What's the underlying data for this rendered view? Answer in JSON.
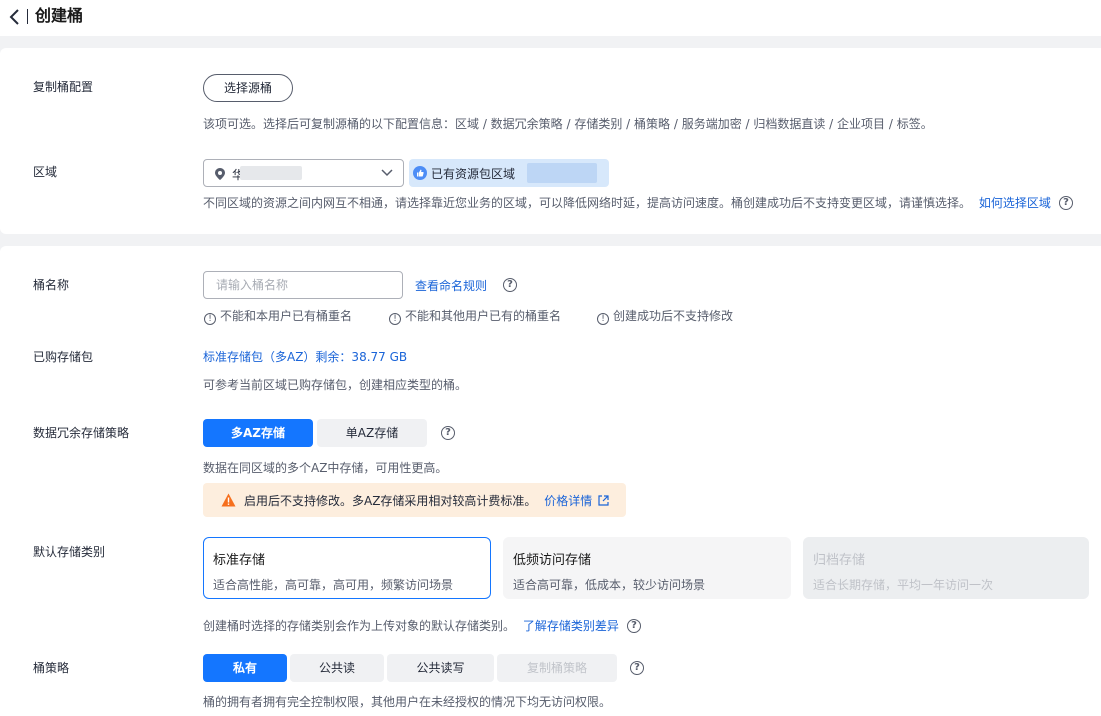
{
  "header": {
    "title": "创建桶"
  },
  "replicate": {
    "label": "复制桶配置",
    "button": "选择源桶",
    "hint": "该项可选。选择后可复制源桶的以下配置信息：区域 / 数据冗余策略 / 存储类别 / 桶策略 / 服务端加密 / 归档数据直读 / 企业项目 / 标签。"
  },
  "region": {
    "label": "区域",
    "select_value": "华",
    "resource_tag": "已有资源包区域",
    "hint": "不同区域的资源之间内网互不相通，请选择靠近您业务的区域，可以降低网络时延，提高访问速度。桶创建成功后不支持变更区域，请谨慎选择。",
    "link": "如何选择区域"
  },
  "bucket_name": {
    "label": "桶名称",
    "placeholder": "请输入桶名称",
    "link": "查看命名规则",
    "rules": [
      "不能和本用户已有桶重名",
      "不能和其他用户已有的桶重名",
      "创建成功后不支持修改"
    ]
  },
  "package": {
    "label": "已购存储包",
    "value": "标准存储包（多AZ）剩余：38.77 GB",
    "hint": "可参考当前区域已购存储包，创建相应类型的桶。"
  },
  "redundancy": {
    "label": "数据冗余存储策略",
    "options": [
      "多AZ存储",
      "单AZ存储"
    ],
    "selected": 0,
    "hint": "数据在同区域的多个AZ中存储，可用性更高。",
    "warning": "启用后不支持修改。多AZ存储采用相对较高计费标准。",
    "warning_link": "价格详情"
  },
  "storage_class": {
    "label": "默认存储类别",
    "options": [
      {
        "title": "标准存储",
        "desc": "适合高性能，高可靠，高可用，频繁访问场景"
      },
      {
        "title": "低频访问存储",
        "desc": "适合高可靠，低成本，较少访问场景"
      },
      {
        "title": "归档存储",
        "desc": "适合长期存储，平均一年访问一次"
      }
    ],
    "hint": "创建桶时选择的存储类别会作为上传对象的默认存储类别。",
    "link": "了解存储类别差异"
  },
  "policy": {
    "label": "桶策略",
    "options": [
      "私有",
      "公共读",
      "公共读写",
      "复制桶策略"
    ],
    "hint": "桶的拥有者拥有完全控制权限，其他用户在未经授权的情况下均无访问权限。"
  },
  "colors": {
    "accent": "#1476ff",
    "link": "#1a64d8",
    "warning_bg": "#fdeede"
  }
}
